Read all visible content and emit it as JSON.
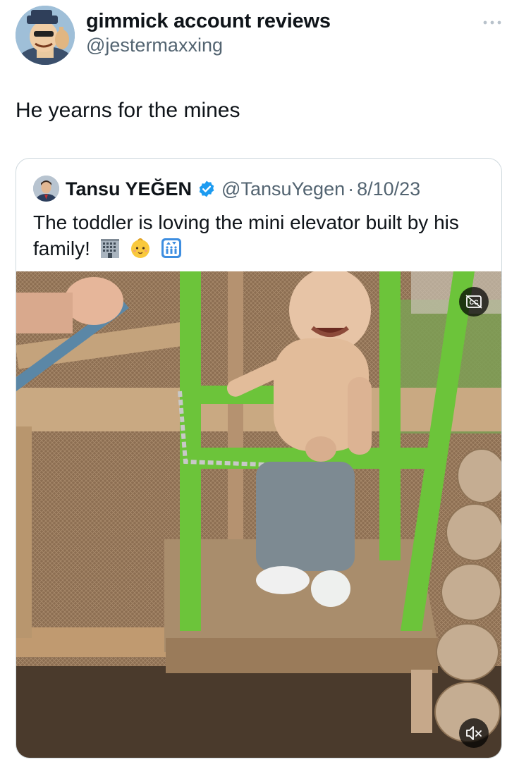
{
  "post": {
    "author": {
      "display_name": "gimmick account reviews",
      "handle": "@jestermaxxing",
      "avatar_icon": "cartoon-avatar-icon"
    },
    "more_icon": "more-horizontal-icon",
    "text": "He yearns for the mines"
  },
  "quote": {
    "author": {
      "display_name": "Tansu YEĞEN",
      "verified_icon": "verified-badge-icon",
      "verified_color": "#1d9bf0",
      "handle": "@TansuYegen",
      "separator": "·",
      "date": "8/10/23"
    },
    "text": "The toddler is loving the mini elevator built by his family!",
    "emojis": [
      "office-building-emoji",
      "baby-emoji",
      "elevator-emoji"
    ],
    "media": {
      "type": "video",
      "cc_icon": "closed-captions-icon",
      "mute_icon": "muted-speaker-icon"
    }
  },
  "colors": {
    "text_primary": "#0f1419",
    "text_secondary": "#536471",
    "card_border": "#cfd9de",
    "elevator_green": "#6cc43a"
  }
}
